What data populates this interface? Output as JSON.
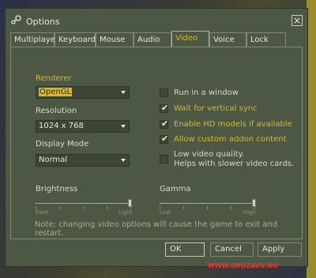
{
  "window": {
    "title": "Options"
  },
  "tabs": [
    {
      "label": "Multiplayer"
    },
    {
      "label": "Keyboard"
    },
    {
      "label": "Mouse"
    },
    {
      "label": "Audio"
    },
    {
      "label": "Video"
    },
    {
      "label": "Voice"
    },
    {
      "label": "Lock"
    }
  ],
  "active_tab": "Video",
  "video": {
    "renderer": {
      "label": "Renderer",
      "value": "OpenGL"
    },
    "resolution": {
      "label": "Resolution",
      "value": "1024 x 768"
    },
    "display_mode": {
      "label": "Display Mode",
      "value": "Normal"
    },
    "checkboxes": [
      {
        "label": "Run in a window",
        "checked": false
      },
      {
        "label": "Wait for vertical sync",
        "checked": true
      },
      {
        "label": "Enable HD models if available",
        "checked": true
      },
      {
        "label": "Allow custom addon content",
        "checked": true
      },
      {
        "label": "Low video quality.",
        "label2": "Helps with slower video cards.",
        "checked": false
      }
    ],
    "brightness": {
      "label": "Brightness",
      "min_label": "Dark",
      "max_label": "Light",
      "level": 1.0
    },
    "gamma": {
      "label": "Gamma",
      "min_label": "Low",
      "max_label": "High",
      "level": 1.0
    },
    "note": "Note: changing video options will cause the game to exit and restart."
  },
  "buttons": {
    "ok": "OK",
    "cancel": "Cancel",
    "apply": "Apply"
  },
  "watermark": "WWW.GROZAVU.RO",
  "colors": {
    "accent": "#d9b62d",
    "panel": "#4c5844"
  }
}
